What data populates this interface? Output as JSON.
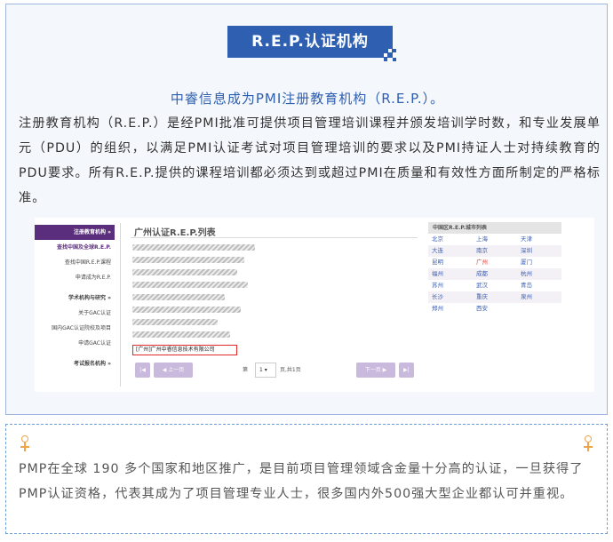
{
  "badge": {
    "title": "R.E.P.认证机构"
  },
  "headline": "中睿信息成为PMI注册教育机构（R.E.P.）。",
  "intro": "注册教育机构（R.E.P.）是经PMI批准可提供项目管理培训课程并颁发培训学时数，和专业发展单元（PDU）的组织，以满足PMI认证考试对项目管理培训的要求以及PMI持证人士对持续教育的PDU要求。所有R.E.P.提供的课程培训都必须达到或超过PMI在质量和有效性方面所制定的严格标准。",
  "screenshot": {
    "sidebar": [
      {
        "label": "注册教育机构 »",
        "style": "active"
      },
      {
        "label": "查找中国及全球R.E.P.",
        "style": "sub"
      },
      {
        "label": "查找中国R.E.P.课程",
        "style": ""
      },
      {
        "label": "申请成为R.E.P.",
        "style": ""
      },
      {
        "label": "",
        "style": "gap"
      },
      {
        "label": "学术机构与研究 »",
        "style": "hd"
      },
      {
        "label": "关于GAC认证",
        "style": ""
      },
      {
        "label": "国内GAC认证院校及项目",
        "style": ""
      },
      {
        "label": "申请GAC认证",
        "style": ""
      },
      {
        "label": "",
        "style": "gap"
      },
      {
        "label": "考试报名机构 »",
        "style": "hd"
      }
    ],
    "list_title": "广州认证R.E.P.列表",
    "highlighted_entry": "[广州]广州中睿信息技术有限公司",
    "pager": {
      "first": "|◀",
      "prev": "◀ 上一页",
      "page_prefix": "第",
      "page_value": "1 ▾",
      "page_suffix": "页,共1页",
      "next": "下一页 ▶",
      "last": "▶|"
    },
    "city_panel": {
      "title": "中国区R.E.P.城市列表",
      "cities": [
        "北京",
        "上海",
        "天津",
        "大连",
        "南京",
        "深圳",
        "昆明",
        "广州",
        "厦门",
        "福州",
        "成都",
        "杭州",
        "苏州",
        "武汉",
        "青岛",
        "长沙",
        "重庆",
        "泉州",
        "郑州",
        "西安",
        ""
      ],
      "highlight": "广州"
    }
  },
  "outro": "PMP在全球 190 多个国家和地区推广，是目前项目管理领域含金量十分高的认证，一旦获得了PMP认证资格，代表其成为了项目管理专业人士，很多国内外500强大型企业都认可并重视。",
  "colors": {
    "accent": "#2e5fb0",
    "purple": "#5b2e7d",
    "highlight_red": "#e02a2a",
    "pin_orange": "#f0a44a"
  }
}
